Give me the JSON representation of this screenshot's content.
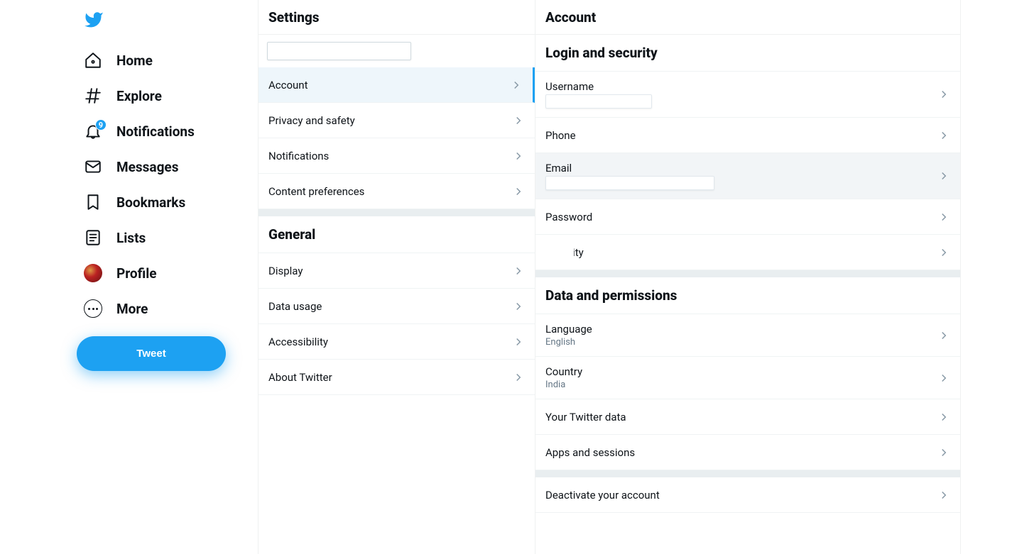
{
  "sidebar": {
    "items": [
      {
        "icon": "home-icon",
        "label": "Home"
      },
      {
        "icon": "explore-icon",
        "label": "Explore"
      },
      {
        "icon": "bell-icon",
        "label": "Notifications",
        "badge": "9"
      },
      {
        "icon": "mail-icon",
        "label": "Messages"
      },
      {
        "icon": "bookmark-icon",
        "label": "Bookmarks"
      },
      {
        "icon": "list-icon",
        "label": "Lists"
      },
      {
        "icon": "profile-icon",
        "label": "Profile"
      },
      {
        "icon": "more-icon",
        "label": "More"
      }
    ],
    "tweet_button": "Tweet"
  },
  "settings": {
    "title": "Settings",
    "search_placeholder": "",
    "groups": [
      {
        "items": [
          {
            "label": "Account",
            "selected": true
          },
          {
            "label": "Privacy and safety"
          },
          {
            "label": "Notifications"
          },
          {
            "label": "Content preferences"
          }
        ]
      },
      {
        "title": "General",
        "items": [
          {
            "label": "Display"
          },
          {
            "label": "Data usage"
          },
          {
            "label": "Accessibility"
          },
          {
            "label": "About Twitter"
          }
        ]
      }
    ]
  },
  "account": {
    "title": "Account",
    "sections": [
      {
        "title": "Login and security",
        "items": [
          {
            "label": "Username",
            "has_masked": true,
            "masked_size": "sm"
          },
          {
            "label": "Phone"
          },
          {
            "label": "Email",
            "has_masked": true,
            "masked_size": "lg",
            "hovered": true
          },
          {
            "label": "Password"
          },
          {
            "label": "Security",
            "partially_obscured": true
          }
        ]
      },
      {
        "title": "Data and permissions",
        "items": [
          {
            "label": "Language",
            "sub": "English"
          },
          {
            "label": "Country",
            "sub": "India"
          },
          {
            "label": "Your Twitter data"
          },
          {
            "label": "Apps and sessions"
          }
        ]
      },
      {
        "items": [
          {
            "label": "Deactivate your account"
          }
        ]
      }
    ]
  }
}
